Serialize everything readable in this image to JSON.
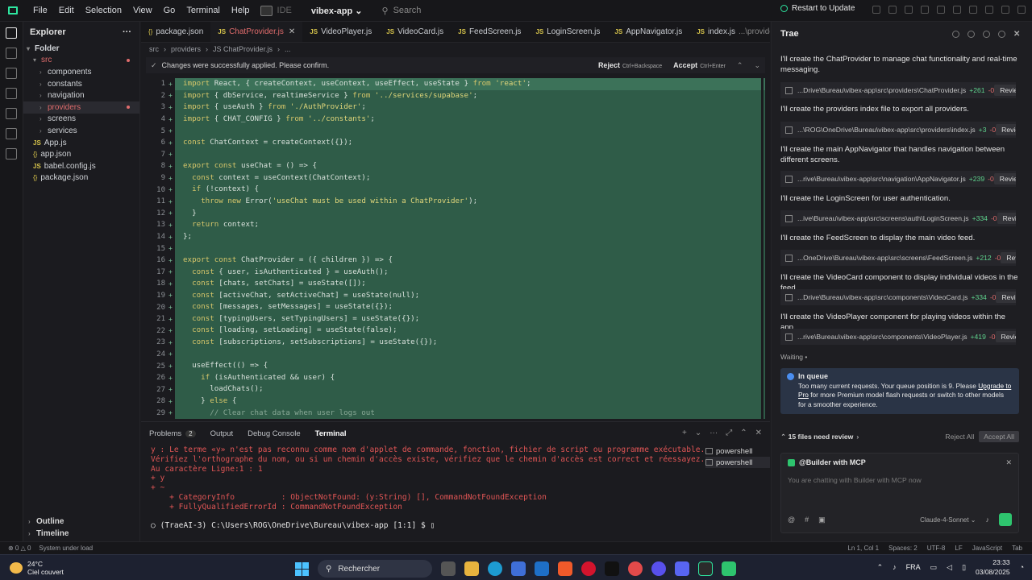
{
  "menu": [
    "File",
    "Edit",
    "Selection",
    "View",
    "Go",
    "Terminal",
    "Help"
  ],
  "ide_label": "IDE",
  "project": "vibex-app",
  "search_placeholder": "Search",
  "restart_label": "Restart to Update",
  "explorer": {
    "title": "Explorer",
    "folder": "Folder",
    "tree": [
      {
        "label": "src",
        "type": "folder",
        "depth": 1,
        "open": true,
        "error": true
      },
      {
        "label": "components",
        "type": "folder",
        "depth": 2
      },
      {
        "label": "constants",
        "type": "folder",
        "depth": 2
      },
      {
        "label": "navigation",
        "type": "folder",
        "depth": 2
      },
      {
        "label": "providers",
        "type": "folder",
        "depth": 2,
        "error": true,
        "selected": true
      },
      {
        "label": "screens",
        "type": "folder",
        "depth": 2
      },
      {
        "label": "services",
        "type": "folder",
        "depth": 2
      },
      {
        "label": "App.js",
        "type": "js",
        "depth": 1
      },
      {
        "label": "app.json",
        "type": "json",
        "depth": 1
      },
      {
        "label": "babel.config.js",
        "type": "js",
        "depth": 1
      },
      {
        "label": "package.json",
        "type": "json",
        "depth": 1
      }
    ],
    "outline": "Outline",
    "timeline": "Timeline"
  },
  "tabs": [
    {
      "label": "package.json",
      "icon": "{}"
    },
    {
      "label": "ChatProvider.js",
      "icon": "JS",
      "active": true
    },
    {
      "label": "VideoPlayer.js",
      "icon": "JS"
    },
    {
      "label": "VideoCard.js",
      "icon": "JS"
    },
    {
      "label": "FeedScreen.js",
      "icon": "JS"
    },
    {
      "label": "LoginScreen.js",
      "icon": "JS"
    },
    {
      "label": "AppNavigator.js",
      "icon": "JS"
    },
    {
      "label": "index.js",
      "icon": "JS",
      "suffix": "...\\providers"
    }
  ],
  "breadcrumb": [
    "src",
    "providers",
    "JS ChatProvider.js",
    "..."
  ],
  "changes": {
    "message": "Changes were successfully applied. Please confirm.",
    "reject": "Reject",
    "reject_key": "Ctrl+Backspace",
    "accept": "Accept",
    "accept_key": "Ctrl+Enter"
  },
  "code_lines": [
    "import React, { createContext, useContext, useEffect, useState } from 'react';",
    "import { dbService, realtimeService } from '../services/supabase';",
    "import { useAuth } from './AuthProvider';",
    "import { CHAT_CONFIG } from '../constants';",
    "",
    "const ChatContext = createContext({});",
    "",
    "export const useChat = () => {",
    "  const context = useContext(ChatContext);",
    "  if (!context) {",
    "    throw new Error('useChat must be used within a ChatProvider');",
    "  }",
    "  return context;",
    "};",
    "",
    "export const ChatProvider = ({ children }) => {",
    "  const { user, isAuthenticated } = useAuth();",
    "  const [chats, setChats] = useState([]);",
    "  const [activeChat, setActiveChat] = useState(null);",
    "  const [messages, setMessages] = useState({});",
    "  const [typingUsers, setTypingUsers] = useState({});",
    "  const [loading, setLoading] = useState(false);",
    "  const [subscriptions, setSubscriptions] = useState({});",
    "",
    "  useEffect(() => {",
    "    if (isAuthenticated && user) {",
    "      loadChats();",
    "    } else {",
    "      // Clear chat data when user logs out"
  ],
  "panel": {
    "tabs": [
      {
        "label": "Problems",
        "badge": "2"
      },
      {
        "label": "Output"
      },
      {
        "label": "Debug Console"
      },
      {
        "label": "Terminal",
        "active": true
      }
    ],
    "terminal": [
      "y : Le terme «y» n'est pas reconnu comme nom d'applet de commande, fonction, fichier de script ou programme exécutable.",
      "Vérifiez l'orthographe du nom, ou si un chemin d'accès existe, vérifiez que le chemin d'accès est correct et réessayez.",
      "Au caractère Ligne:1 : 1",
      "+ y",
      "+ ~",
      "    + CategoryInfo          : ObjectNotFound: (y:String) [], CommandNotFoundException",
      "    + FullyQualifiedErrorId : CommandNotFoundException"
    ],
    "prompt": "(TraeAI-3) C:\\Users\\ROG\\OneDrive\\Bureau\\vibex-app [1:1] $ ",
    "shells": [
      "powershell",
      "powershell"
    ]
  },
  "chat": {
    "title": "Trae",
    "items": [
      {
        "msg": "I'll create the ChatProvider to manage chat functionality and real-time messaging.",
        "path": "...Drive\\Bureau\\vibex-app\\src\\providers\\ChatProvider.js",
        "plus": "+261",
        "minus": "-0"
      },
      {
        "msg": "I'll create the providers index file to export all providers.",
        "path": "...\\ROG\\OneDrive\\Bureau\\vibex-app\\src\\providers\\index.js",
        "plus": "+3",
        "minus": "-0"
      },
      {
        "msg": "I'll create the main AppNavigator that handles navigation between different screens.",
        "path": "...rive\\Bureau\\vibex-app\\src\\navigation\\AppNavigator.js",
        "plus": "+239",
        "minus": "-0"
      },
      {
        "msg": "I'll create the LoginScreen for user authentication.",
        "path": "...ive\\Bureau\\vibex-app\\src\\screens\\auth\\LoginScreen.js",
        "plus": "+334",
        "minus": "-0"
      },
      {
        "msg": "I'll create the FeedScreen to display the main video feed.",
        "path": "...OneDrive\\Bureau\\vibex-app\\src\\screens\\FeedScreen.js",
        "plus": "+212",
        "minus": "-0"
      },
      {
        "msg": "I'll create the VideoCard component to display individual videos in the feed.",
        "path": "...Drive\\Bureau\\vibex-app\\src\\components\\VideoCard.js",
        "plus": "+334",
        "minus": "-0"
      },
      {
        "msg": "I'll create the VideoPlayer component for playing videos within the app.",
        "path": "...rive\\Bureau\\vibex-app\\src\\components\\VideoPlayer.js",
        "plus": "+419",
        "minus": "-0"
      }
    ],
    "review_label": "Review",
    "waiting": "Waiting •",
    "queue_title": "In queue",
    "queue_text_1": "Too many current requests. Your queue position is 9. Please ",
    "queue_link": "Upgrade to Pro",
    "queue_text_2": " for more Premium model flash requests or switch to other models for a smoother experience.",
    "files_review": "15 files need review",
    "reject_all": "Reject All",
    "accept_all": "Accept All",
    "builder_title": "@Builder with MCP",
    "builder_placeholder": "You are chatting with Builder with MCP now",
    "model": "Claude-4-Sonnet"
  },
  "status": {
    "left": "System under load",
    "cursor": "Ln 1, Col 1",
    "spaces": "Spaces: 2",
    "enc": "UTF-8",
    "eol": "LF",
    "lang": "JavaScript",
    "tab": "Tab"
  },
  "taskbar": {
    "temp": "24°C",
    "weather": "Ciel couvert",
    "search": "Rechercher",
    "lang": "FRA",
    "time": "23:33",
    "date": "03/08/2025"
  }
}
